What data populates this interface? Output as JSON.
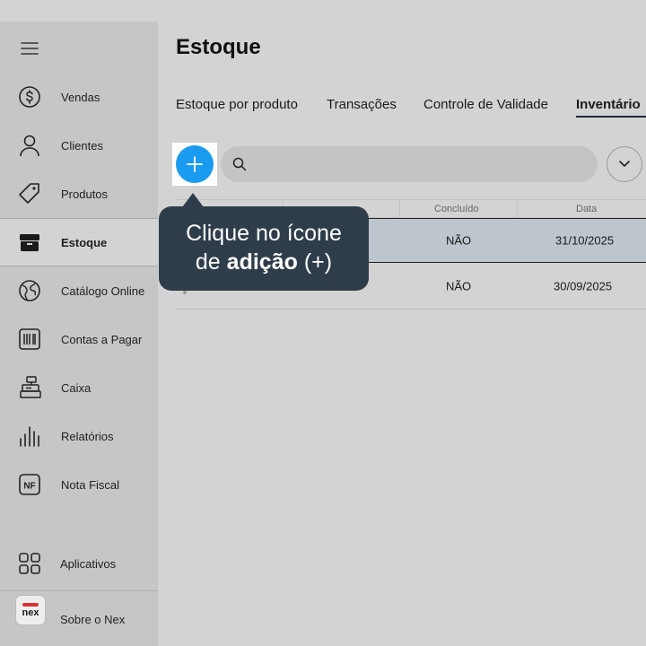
{
  "sidebar": {
    "items": [
      {
        "label": "Vendas",
        "icon": "dollar-circle-icon"
      },
      {
        "label": "Clientes",
        "icon": "user-icon"
      },
      {
        "label": "Produtos",
        "icon": "tag-icon"
      },
      {
        "label": "Estoque",
        "icon": "box-icon"
      },
      {
        "label": "Catálogo Online",
        "icon": "globe-icon"
      },
      {
        "label": "Contas a Pagar",
        "icon": "barcode-icon"
      },
      {
        "label": "Caixa",
        "icon": "cash-register-icon"
      },
      {
        "label": "Relatórios",
        "icon": "bar-chart-icon"
      },
      {
        "label": "Nota Fiscal",
        "icon": "nf-icon"
      }
    ],
    "apps_label": "Aplicativos",
    "about_label": "Sobre o Nex",
    "logo_text": "nex"
  },
  "main": {
    "title": "Estoque",
    "tabs": [
      {
        "label": "Estoque por produto"
      },
      {
        "label": "Transações"
      },
      {
        "label": "Controle de Validade"
      },
      {
        "label": "Inventário"
      }
    ],
    "search": {
      "placeholder": "",
      "value": ""
    },
    "table": {
      "headers": [
        "Concluído",
        "Data"
      ],
      "rows": [
        {
          "concluido": "NÃO",
          "data": "31/10/2025"
        },
        {
          "concluido": "NÃO",
          "data": "30/09/2025"
        }
      ]
    }
  },
  "tooltip": {
    "line1": "Clique no ícone",
    "line2_prefix": "de ",
    "line2_bold": "adição",
    "line2_suffix": " (+)"
  },
  "colors": {
    "accent": "#1a9bef",
    "tooltip_bg": "#2f3d4b",
    "sidebar_bg": "#c6c6c6",
    "main_bg": "#d3d3d3",
    "logo_red": "#d9342f"
  }
}
